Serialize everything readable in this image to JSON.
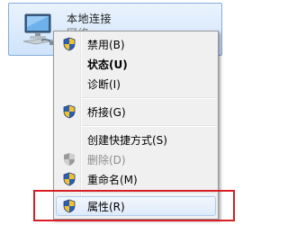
{
  "connection": {
    "title": "本地连接",
    "subtitle": "网络"
  },
  "menu": {
    "items": [
      {
        "label": "禁用(B)",
        "icon": "uac-shield-icon"
      },
      {
        "label": "状态(U)"
      },
      {
        "label": "诊断(I)"
      },
      {
        "label": "桥接(G)",
        "icon": "uac-shield-icon"
      },
      {
        "label": "创建快捷方式(S)"
      },
      {
        "label": "删除(D)",
        "icon": "uac-shield-icon",
        "disabled": true
      },
      {
        "label": "重命名(M)",
        "icon": "uac-shield-icon"
      },
      {
        "label": "属性(R)",
        "icon": "uac-shield-icon",
        "highlighted": true
      }
    ]
  },
  "colors": {
    "annotation_box": "#d61e24",
    "selection": "#cfe3fb"
  }
}
